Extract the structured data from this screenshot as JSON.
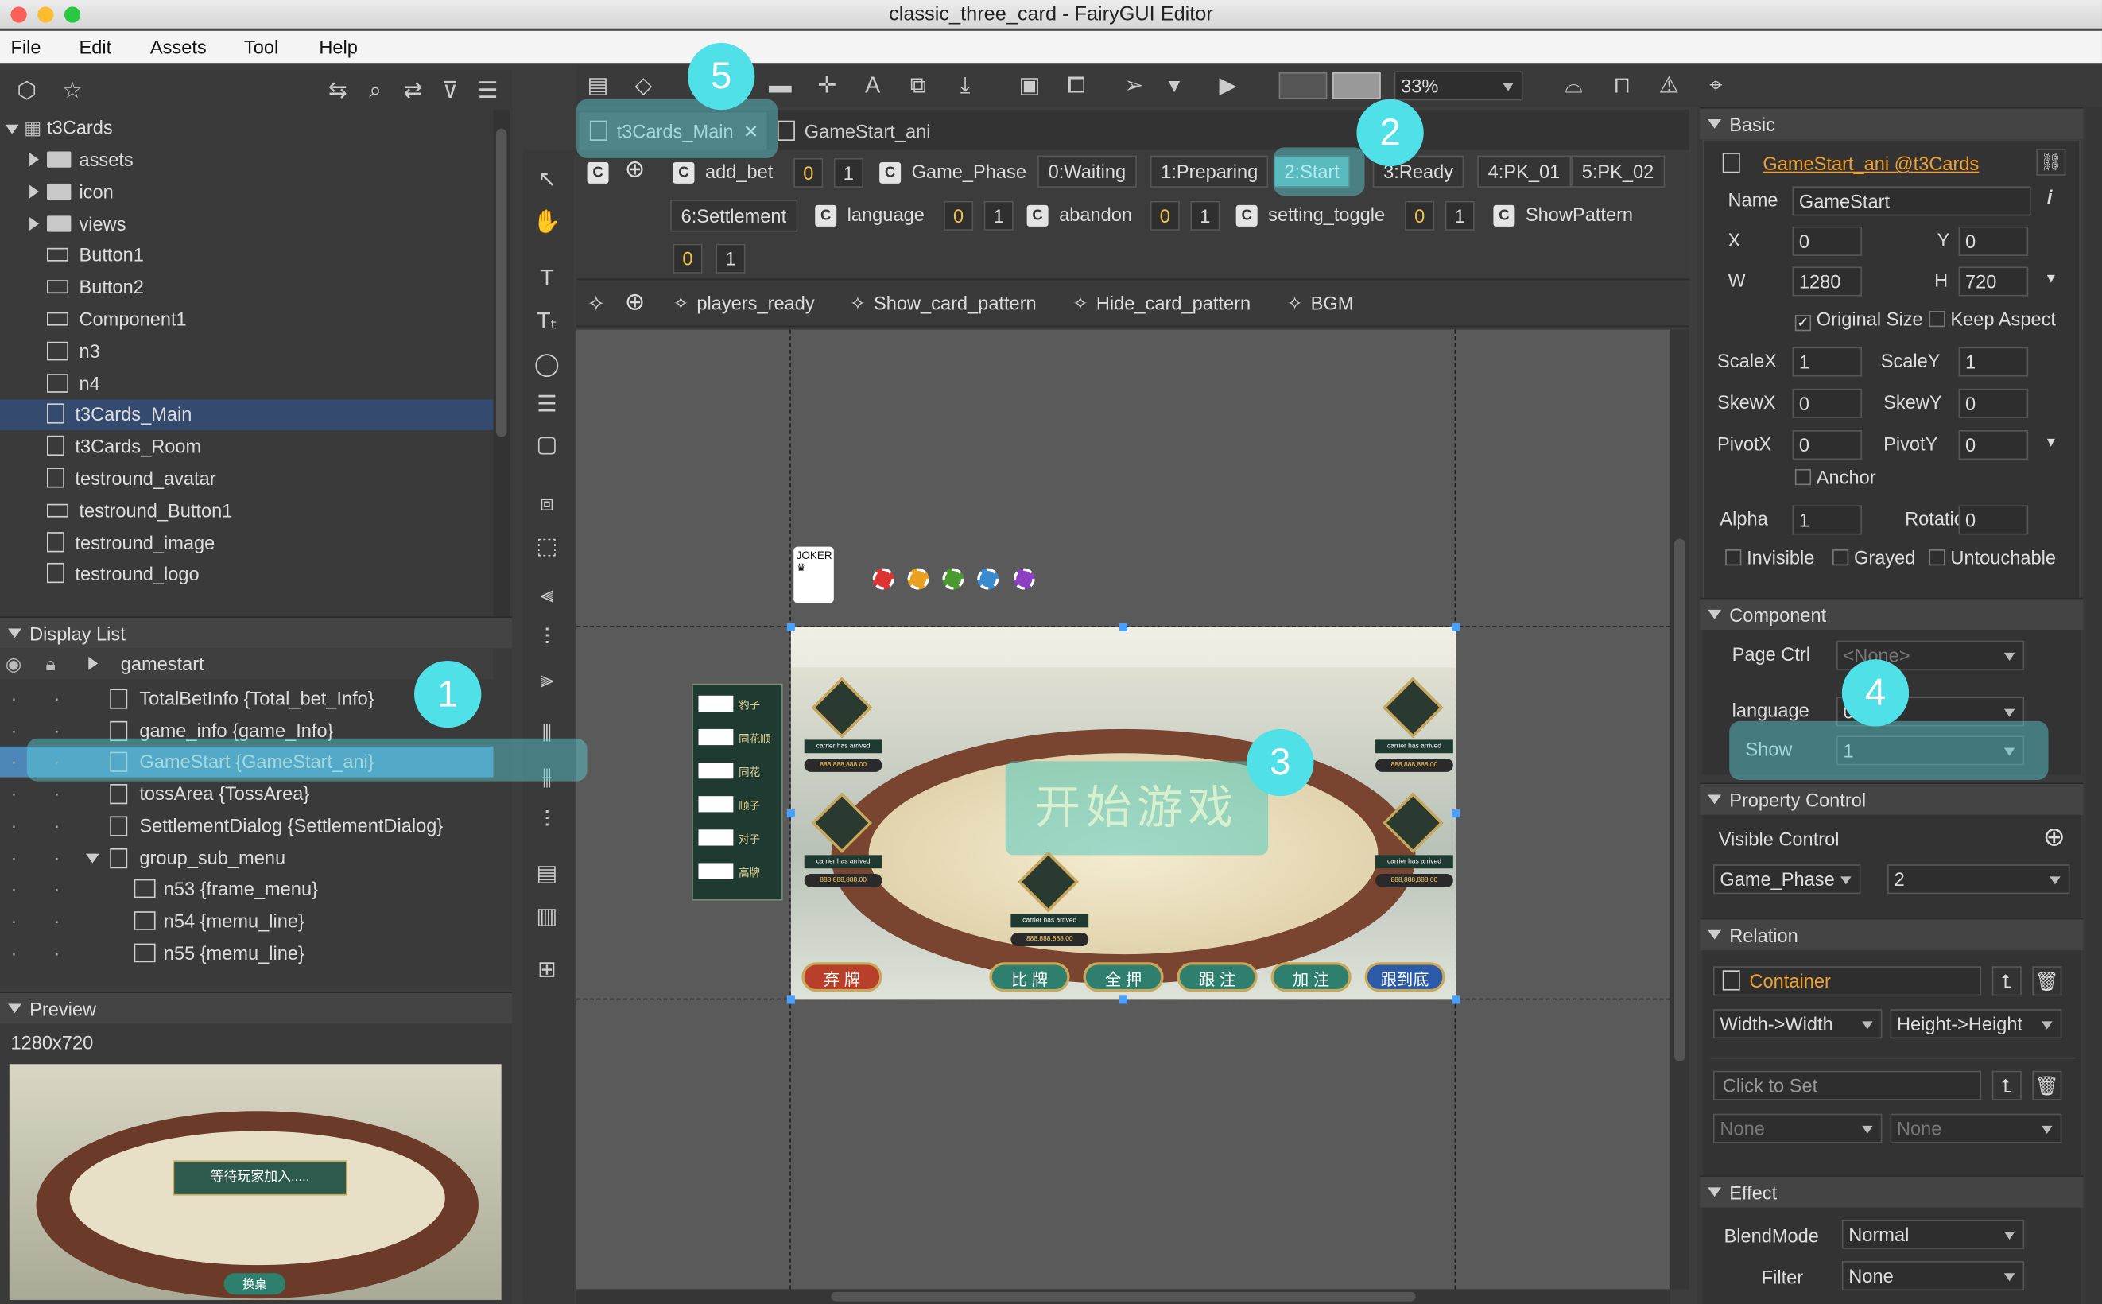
{
  "window_title": "classic_three_card - FairyGUI Editor",
  "menu": [
    "File",
    "Edit",
    "Assets",
    "Tool",
    "Help"
  ],
  "library": {
    "root": "t3Cards",
    "items": [
      {
        "label": "assets",
        "type": "folder"
      },
      {
        "label": "icon",
        "type": "folder"
      },
      {
        "label": "views",
        "type": "folder"
      },
      {
        "label": "Button1",
        "type": "comp"
      },
      {
        "label": "Button2",
        "type": "comp"
      },
      {
        "label": "Component1",
        "type": "comp"
      },
      {
        "label": "n3",
        "type": "image"
      },
      {
        "label": "n4",
        "type": "image"
      },
      {
        "label": "t3Cards_Main",
        "type": "doc",
        "selected": true
      },
      {
        "label": "t3Cards_Room",
        "type": "doc"
      },
      {
        "label": "testround_avatar",
        "type": "doc"
      },
      {
        "label": "testround_Button1",
        "type": "comp"
      },
      {
        "label": "testround_image",
        "type": "doc"
      },
      {
        "label": "testround_logo",
        "type": "doc"
      }
    ]
  },
  "display_list": {
    "title": "Display List",
    "root": "gamestart",
    "items": [
      {
        "label": "TotalBetInfo {Total_bet_Info}",
        "indent": 0
      },
      {
        "label": "game_info {game_Info}",
        "indent": 0
      },
      {
        "label": "GameStart {GameStart_ani}",
        "indent": 0,
        "selected": true
      },
      {
        "label": "tossArea {TossArea}",
        "indent": 0
      },
      {
        "label": "SettlementDialog {SettlementDialog}",
        "indent": 0
      },
      {
        "label": "group_sub_menu",
        "indent": 0,
        "group": true
      },
      {
        "label": "n53 {frame_menu}",
        "indent": 1
      },
      {
        "label": "n54 {memu_line}",
        "indent": 1
      },
      {
        "label": "n55 {memu_line}",
        "indent": 1
      }
    ]
  },
  "preview": {
    "title": "Preview",
    "size": "1280x720",
    "waiting_text": "等待玩家加入.....",
    "btn": "换桌"
  },
  "toolbar": {
    "zoom": "33%"
  },
  "tabs": [
    {
      "label": "t3Cards_Main",
      "active": true
    },
    {
      "label": "GameStart_ani"
    }
  ],
  "controllers": {
    "add_bet": [
      "0",
      "1"
    ],
    "Game_Phase": [
      "0:Waiting",
      "1:Preparing",
      "2:Start",
      "3:Ready",
      "4:PK_01",
      "5:PK_02",
      "6:Settlement"
    ],
    "language": [
      "0",
      "1"
    ],
    "abandon": [
      "0",
      "1"
    ],
    "setting_toggle": [
      "0",
      "1"
    ],
    "ShowPattern": [
      "0",
      "1"
    ],
    "names": {
      "add_bet": "add_bet",
      "game_phase": "Game_Phase",
      "language": "language",
      "abandon": "abandon",
      "setting_toggle": "setting_toggle",
      "show_pattern": "ShowPattern"
    }
  },
  "transitions": [
    "players_ready",
    "Show_card_pattern",
    "Hide_card_pattern",
    "BGM"
  ],
  "canvas": {
    "start_text": "开始游戏",
    "player_tag": "carrier has arrived",
    "money": "888,888,888.00",
    "buttons": [
      "弃 牌",
      "比 牌",
      "全 押",
      "跟 注",
      "加 注",
      "跟到底"
    ],
    "pattern_labels": [
      "豹子",
      "同花顺",
      "同花",
      "顺子",
      "对子",
      "高牌"
    ]
  },
  "inspector": {
    "basic": "Basic",
    "ref": "GameStart_ani @t3Cards",
    "name_label": "Name",
    "name": "GameStart",
    "x": "0",
    "y": "0",
    "w": "1280",
    "h": "720",
    "original_size": "Original Size",
    "keep_aspect": "Keep Aspect",
    "scalex": "1",
    "scaley": "1",
    "skewx": "0",
    "skewy": "0",
    "pivotx": "0",
    "pivoty": "0",
    "anchor": "Anchor",
    "alpha": "1",
    "rotation": "0",
    "invisible": "Invisible",
    "grayed": "Grayed",
    "untouchable": "Untouchable",
    "component": "Component",
    "page_ctrl": "Page Ctrl",
    "page_ctrl_val": "<None>",
    "language": "language",
    "language_val": "0",
    "show": "Show",
    "show_val": "1",
    "property_control": "Property Control",
    "visible_control": "Visible Control",
    "vc_ctrl": "Game_Phase",
    "vc_page": "2",
    "relation": "Relation",
    "container": "Container",
    "rel_w": "Width->Width",
    "rel_h": "Height->Height",
    "click_to_set": "Click to Set",
    "none1": "None",
    "none2": "None",
    "effect": "Effect",
    "blendmode_label": "BlendMode",
    "blendmode": "Normal",
    "filter_label": "Filter",
    "filter": "None"
  },
  "labels": {
    "x": "X",
    "y": "Y",
    "w": "W",
    "h": "H",
    "scalex": "ScaleX",
    "scaley": "ScaleY",
    "skewx": "SkewX",
    "skewy": "SkewY",
    "pivotx": "PivotX",
    "pivoty": "PivotY",
    "alpha": "Alpha",
    "rotation": "Rotation"
  },
  "badges": [
    "1",
    "2",
    "3",
    "4",
    "5"
  ],
  "colors": {
    "accent": "#4fe0e8",
    "selection": "#344a6e",
    "link": "#f0a030"
  }
}
